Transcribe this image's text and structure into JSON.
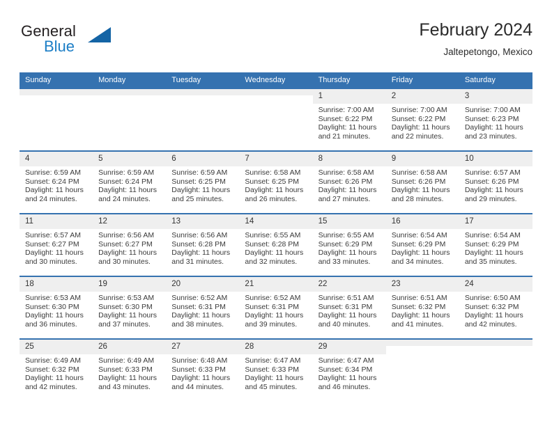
{
  "brand": {
    "word_top": "General",
    "word_bottom": "Blue",
    "accent_color": "#1c7ec6",
    "triangle_color": "#1464a5",
    "triangle_icon": "triangle-icon"
  },
  "header": {
    "title": "February 2024",
    "subtitle": "Jaltepetongo, Mexico"
  },
  "theme": {
    "header_bg": "#3572b0",
    "header_text": "#ffffff",
    "daynum_bg": "#efefef",
    "cell_bg": "#ffffff",
    "row_border": "#3572b0"
  },
  "weekday_headers": [
    "Sunday",
    "Monday",
    "Tuesday",
    "Wednesday",
    "Thursday",
    "Friday",
    "Saturday"
  ],
  "weeks": [
    [
      {
        "day": "",
        "lines": []
      },
      {
        "day": "",
        "lines": []
      },
      {
        "day": "",
        "lines": []
      },
      {
        "day": "",
        "lines": []
      },
      {
        "day": "1",
        "lines": [
          "Sunrise: 7:00 AM",
          "Sunset: 6:22 PM",
          "Daylight: 11 hours",
          "and 21 minutes."
        ]
      },
      {
        "day": "2",
        "lines": [
          "Sunrise: 7:00 AM",
          "Sunset: 6:22 PM",
          "Daylight: 11 hours",
          "and 22 minutes."
        ]
      },
      {
        "day": "3",
        "lines": [
          "Sunrise: 7:00 AM",
          "Sunset: 6:23 PM",
          "Daylight: 11 hours",
          "and 23 minutes."
        ]
      }
    ],
    [
      {
        "day": "4",
        "lines": [
          "Sunrise: 6:59 AM",
          "Sunset: 6:24 PM",
          "Daylight: 11 hours",
          "and 24 minutes."
        ]
      },
      {
        "day": "5",
        "lines": [
          "Sunrise: 6:59 AM",
          "Sunset: 6:24 PM",
          "Daylight: 11 hours",
          "and 24 minutes."
        ]
      },
      {
        "day": "6",
        "lines": [
          "Sunrise: 6:59 AM",
          "Sunset: 6:25 PM",
          "Daylight: 11 hours",
          "and 25 minutes."
        ]
      },
      {
        "day": "7",
        "lines": [
          "Sunrise: 6:58 AM",
          "Sunset: 6:25 PM",
          "Daylight: 11 hours",
          "and 26 minutes."
        ]
      },
      {
        "day": "8",
        "lines": [
          "Sunrise: 6:58 AM",
          "Sunset: 6:26 PM",
          "Daylight: 11 hours",
          "and 27 minutes."
        ]
      },
      {
        "day": "9",
        "lines": [
          "Sunrise: 6:58 AM",
          "Sunset: 6:26 PM",
          "Daylight: 11 hours",
          "and 28 minutes."
        ]
      },
      {
        "day": "10",
        "lines": [
          "Sunrise: 6:57 AM",
          "Sunset: 6:26 PM",
          "Daylight: 11 hours",
          "and 29 minutes."
        ]
      }
    ],
    [
      {
        "day": "11",
        "lines": [
          "Sunrise: 6:57 AM",
          "Sunset: 6:27 PM",
          "Daylight: 11 hours",
          "and 30 minutes."
        ]
      },
      {
        "day": "12",
        "lines": [
          "Sunrise: 6:56 AM",
          "Sunset: 6:27 PM",
          "Daylight: 11 hours",
          "and 30 minutes."
        ]
      },
      {
        "day": "13",
        "lines": [
          "Sunrise: 6:56 AM",
          "Sunset: 6:28 PM",
          "Daylight: 11 hours",
          "and 31 minutes."
        ]
      },
      {
        "day": "14",
        "lines": [
          "Sunrise: 6:55 AM",
          "Sunset: 6:28 PM",
          "Daylight: 11 hours",
          "and 32 minutes."
        ]
      },
      {
        "day": "15",
        "lines": [
          "Sunrise: 6:55 AM",
          "Sunset: 6:29 PM",
          "Daylight: 11 hours",
          "and 33 minutes."
        ]
      },
      {
        "day": "16",
        "lines": [
          "Sunrise: 6:54 AM",
          "Sunset: 6:29 PM",
          "Daylight: 11 hours",
          "and 34 minutes."
        ]
      },
      {
        "day": "17",
        "lines": [
          "Sunrise: 6:54 AM",
          "Sunset: 6:29 PM",
          "Daylight: 11 hours",
          "and 35 minutes."
        ]
      }
    ],
    [
      {
        "day": "18",
        "lines": [
          "Sunrise: 6:53 AM",
          "Sunset: 6:30 PM",
          "Daylight: 11 hours",
          "and 36 minutes."
        ]
      },
      {
        "day": "19",
        "lines": [
          "Sunrise: 6:53 AM",
          "Sunset: 6:30 PM",
          "Daylight: 11 hours",
          "and 37 minutes."
        ]
      },
      {
        "day": "20",
        "lines": [
          "Sunrise: 6:52 AM",
          "Sunset: 6:31 PM",
          "Daylight: 11 hours",
          "and 38 minutes."
        ]
      },
      {
        "day": "21",
        "lines": [
          "Sunrise: 6:52 AM",
          "Sunset: 6:31 PM",
          "Daylight: 11 hours",
          "and 39 minutes."
        ]
      },
      {
        "day": "22",
        "lines": [
          "Sunrise: 6:51 AM",
          "Sunset: 6:31 PM",
          "Daylight: 11 hours",
          "and 40 minutes."
        ]
      },
      {
        "day": "23",
        "lines": [
          "Sunrise: 6:51 AM",
          "Sunset: 6:32 PM",
          "Daylight: 11 hours",
          "and 41 minutes."
        ]
      },
      {
        "day": "24",
        "lines": [
          "Sunrise: 6:50 AM",
          "Sunset: 6:32 PM",
          "Daylight: 11 hours",
          "and 42 minutes."
        ]
      }
    ],
    [
      {
        "day": "25",
        "lines": [
          "Sunrise: 6:49 AM",
          "Sunset: 6:32 PM",
          "Daylight: 11 hours",
          "and 42 minutes."
        ]
      },
      {
        "day": "26",
        "lines": [
          "Sunrise: 6:49 AM",
          "Sunset: 6:33 PM",
          "Daylight: 11 hours",
          "and 43 minutes."
        ]
      },
      {
        "day": "27",
        "lines": [
          "Sunrise: 6:48 AM",
          "Sunset: 6:33 PM",
          "Daylight: 11 hours",
          "and 44 minutes."
        ]
      },
      {
        "day": "28",
        "lines": [
          "Sunrise: 6:47 AM",
          "Sunset: 6:33 PM",
          "Daylight: 11 hours",
          "and 45 minutes."
        ]
      },
      {
        "day": "29",
        "lines": [
          "Sunrise: 6:47 AM",
          "Sunset: 6:34 PM",
          "Daylight: 11 hours",
          "and 46 minutes."
        ]
      },
      {
        "day": "",
        "lines": []
      },
      {
        "day": "",
        "lines": []
      }
    ]
  ]
}
